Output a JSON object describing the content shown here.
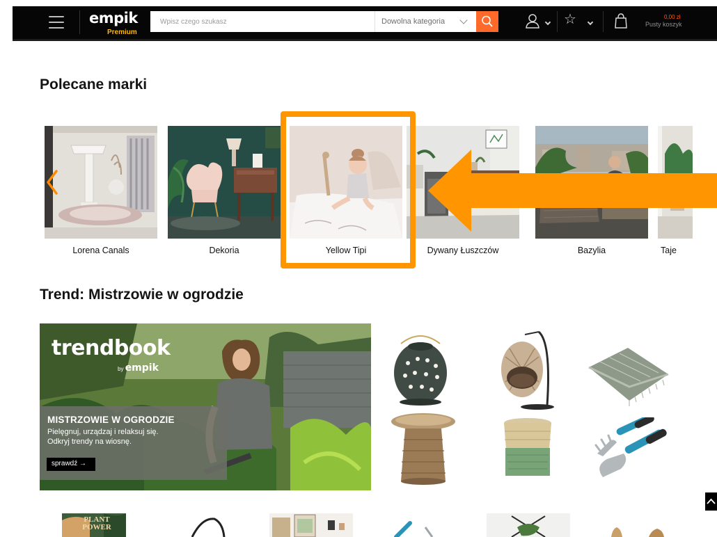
{
  "header": {
    "logo_name": "empik",
    "logo_tier": "Premium",
    "search_placeholder": "Wpisz czego szukasz",
    "category_label": "Dowolna kategoria",
    "cart_price": "0,00 zł",
    "cart_label": "Pusty koszyk",
    "icons": [
      "menu-icon",
      "search-icon",
      "user-icon",
      "star-icon",
      "shopping-bag-icon"
    ],
    "colors": {
      "accent": "#ff6a2a",
      "premium": "#ffb700",
      "bar": "#060606"
    }
  },
  "brands": {
    "title": "Polecane marki",
    "items": [
      {
        "label": "Lorena Canals"
      },
      {
        "label": "Dekoria"
      },
      {
        "label": "Yellow Tipi"
      },
      {
        "label": "Dywany Łuszczów"
      },
      {
        "label": "Bazylia"
      },
      {
        "label": "Taje"
      }
    ],
    "highlight_color": "#ff9500"
  },
  "trend": {
    "title": "Trend: Mistrzowie w ogrodzie",
    "banner": {
      "logo": "trendbook",
      "by": "by",
      "by_brand": "empik",
      "heading": "MISTRZOWIE W OGRODZIE",
      "line1": "Pielęgnuj, urządzaj i relaksuj się.",
      "line2": "Odkryj trendy na wiosnę.",
      "cta": "sprawdź"
    },
    "products": [
      {
        "name": "lantern"
      },
      {
        "name": "hanging-chair"
      },
      {
        "name": "blanket"
      },
      {
        "name": "rattan-stool"
      },
      {
        "name": "basket"
      },
      {
        "name": "garden-tools"
      }
    ]
  },
  "bottom_row": {
    "first_label": "PLANT POWER"
  }
}
